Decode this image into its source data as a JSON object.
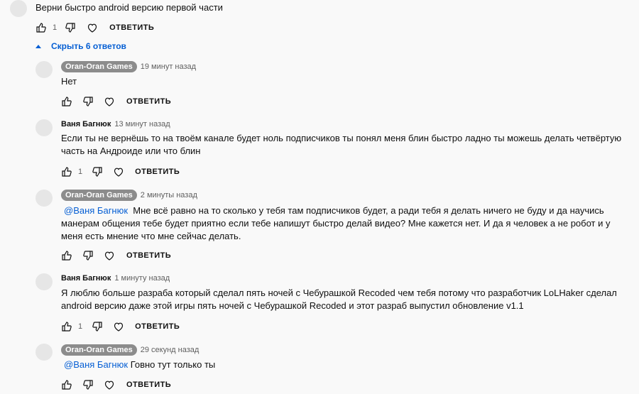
{
  "top_comment": {
    "text": "Верни быстро android версию первой части",
    "likes": "1",
    "reply_label": "ОТВЕТИТЬ"
  },
  "toggle_label": "Скрыть 6 ответов",
  "replies": [
    {
      "author": "Oran-Oran Games",
      "time": "19 минут назад",
      "mention": "",
      "text": "Нет",
      "likes": "",
      "reply_label": "ОТВЕТИТЬ"
    },
    {
      "author": "Ваня Багнюк",
      "time": "13 минут назад",
      "mention": "",
      "text": "Если ты не вернёшь то на твоём канале будет ноль подписчиков ты понял меня блин быстро ладно ты можешь делать четвёртую",
      "text2": "часть на Андроиде или что блин",
      "likes": "1",
      "reply_label": "ОТВЕТИТЬ"
    },
    {
      "author": "Oran-Oran Games",
      "time": "2 минуты назад",
      "mention": "@Ваня Багнюк",
      "text": "Мне всё равно на то сколько у тебя там подписчиков будет, а ради тебя я делать ничего не буду и да научись",
      "text2": "манерам общения тебе будет приятно если тебе напишут быстро делай видео? Мне кажется нет. И да я человек а не робот и у",
      "text3": "меня есть мнение что мне сейчас делать.",
      "likes": "",
      "reply_label": "ОТВЕТИТЬ"
    },
    {
      "author": "Ваня Багнюк",
      "time": "1 минуту назад",
      "mention": "",
      "text": "Я люблю больше разраба который сделал пять ночей с Чебурашкой Recoded чем тебя потому что разработчик LoLHaker сделал",
      "text2": "android версию даже этой игры пять ночей с Чебурашкой Recoded и этот разраб выпустил обновление v1.1",
      "likes": "1",
      "reply_label": "ОТВЕТИТЬ"
    },
    {
      "author": "Oran-Oran Games",
      "time": "29 секунд назад",
      "mention": "@Ваня Багнюк",
      "text": "Говно тут только ты",
      "likes": "",
      "reply_label": "ОТВЕТИТЬ"
    }
  ]
}
